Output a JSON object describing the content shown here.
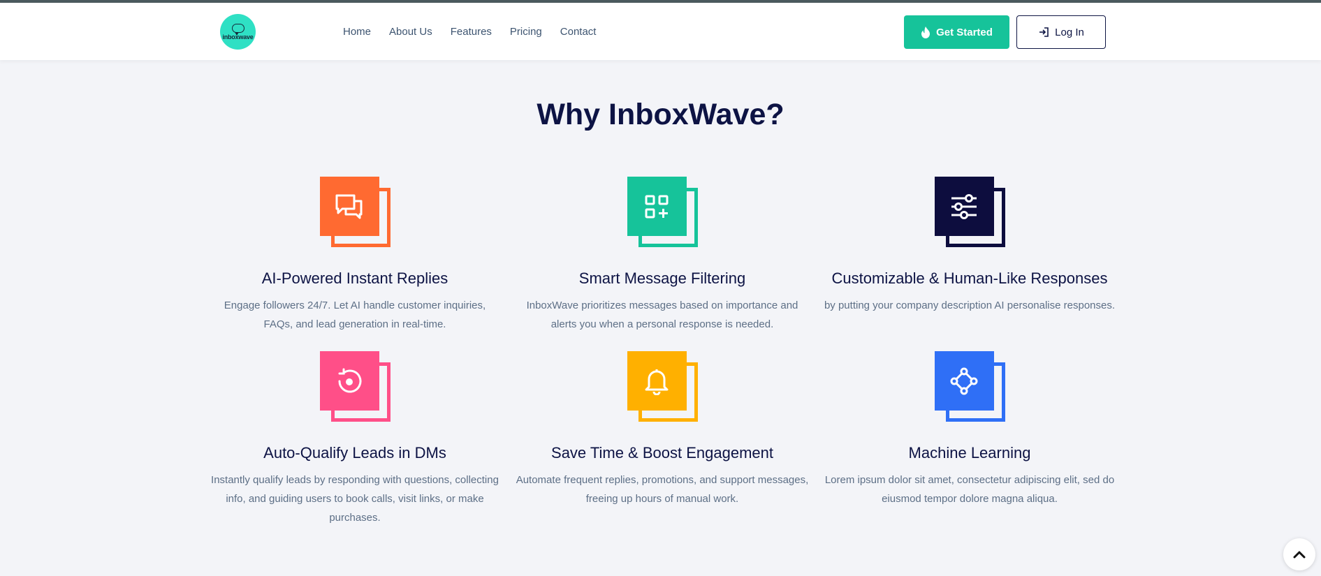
{
  "brand": {
    "logo_text": "inboxwave"
  },
  "nav": {
    "items": [
      "Home",
      "About Us",
      "Features",
      "Pricing",
      "Contact"
    ]
  },
  "header_actions": {
    "get_started": "Get Started",
    "login": "Log In"
  },
  "section": {
    "title": "Why InboxWave?"
  },
  "features": [
    {
      "title": "AI-Powered Instant Replies",
      "description": "Engage followers 24/7. Let AI handle customer inquiries, FAQs, and lead generation in real-time.",
      "icon": "chat-bubbles-icon",
      "color": "#ff6a31"
    },
    {
      "title": "Smart Message Filtering",
      "description": "InboxWave prioritizes messages based on importance and alerts you when a personal response is needed.",
      "icon": "apps-add-icon",
      "color": "#16c39a"
    },
    {
      "title": "Customizable & Human-Like Responses",
      "description": "by putting your company description AI personalise responses.",
      "icon": "sliders-icon",
      "color": "#0d0d3e"
    },
    {
      "title": "Auto-Qualify Leads in DMs",
      "description": "Instantly qualify leads by responding with questions, collecting info, and guiding users to book calls, visit links, or make purchases.",
      "icon": "rotate-target-icon",
      "color": "#ff4f88"
    },
    {
      "title": "Save Time & Boost Engagement",
      "description": "Automate frequent replies, promotions, and support messages, freeing up hours of manual work.",
      "icon": "bell-icon",
      "color": "#ffb000"
    },
    {
      "title": "Machine Learning",
      "description": "Lorem ipsum dolor sit amet, consectetur adipiscing elit, sed do eiusmod tempor dolore magna aliqua.",
      "icon": "nodes-diamond-icon",
      "color": "#2f6ff6"
    }
  ]
}
